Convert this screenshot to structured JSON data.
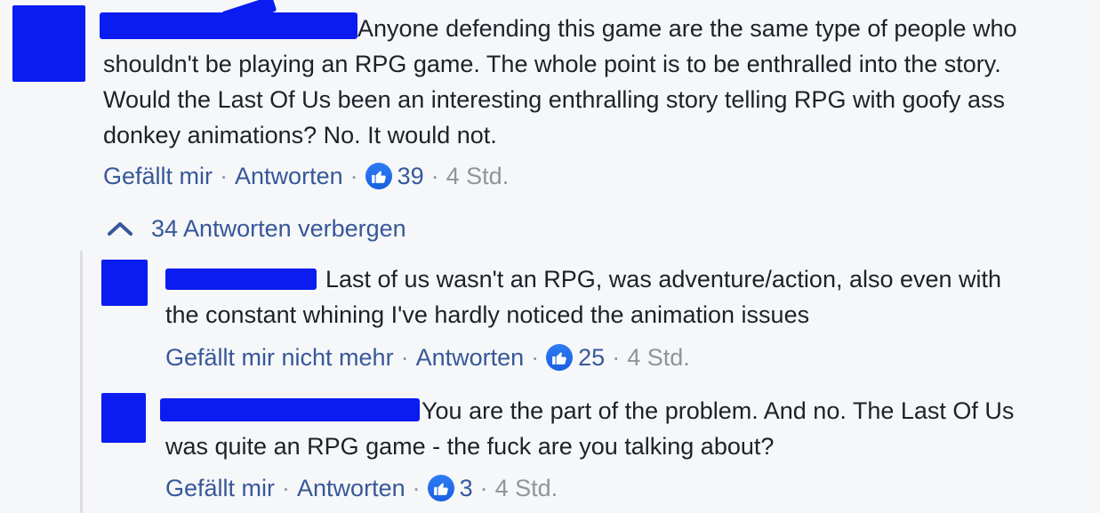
{
  "comments": [
    {
      "text": "Anyone defending this game are the same type of people who shouldn't be playing an RPG game. The whole point is to be enthralled into the story. Would the Last Of Us been an interesting enthralling story telling RPG with goofy ass donkey animations? No. It would not.",
      "like_label": "Gefällt mir",
      "reply_label": "Antworten",
      "likes": "39",
      "time": "4 Std."
    }
  ],
  "replies_toggle": {
    "label": "34 Antworten verbergen"
  },
  "replies": [
    {
      "text": "Last of us wasn't an RPG, was adventure/action, also even with the constant whining I've hardly noticed the animation issues",
      "like_label": "Gefällt mir nicht mehr",
      "reply_label": "Antworten",
      "likes": "25",
      "time": "4 Std."
    },
    {
      "text": "You are the part of the problem. And no. The Last Of Us was quite an RPG game - the fuck are you talking about?",
      "like_label": "Gefällt mir",
      "reply_label": "Antworten",
      "likes": "3",
      "time": "4 Std."
    }
  ],
  "icons": {
    "like": "thumbs-up-icon",
    "toggle": "chevron-up-icon"
  },
  "colors": {
    "link": "#365899",
    "meta": "#90949c",
    "redaction": "#0a1cf0",
    "like_badge": "#2d7cf6"
  }
}
